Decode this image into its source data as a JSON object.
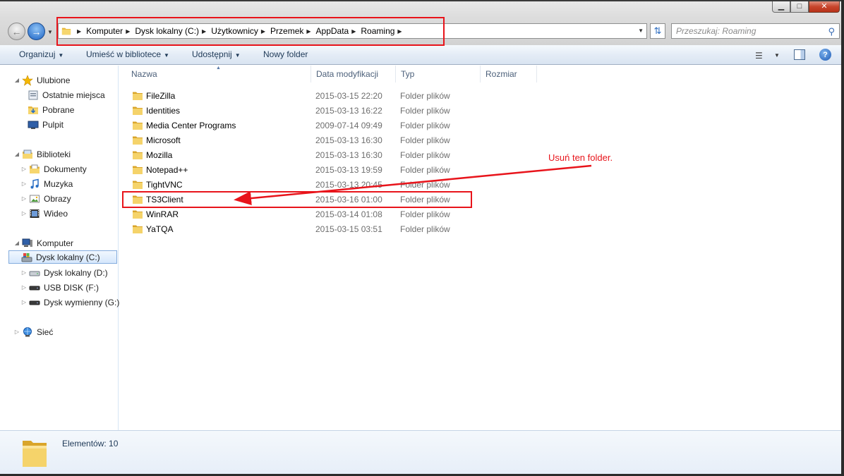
{
  "window": {
    "controls": {
      "minimize": "▁",
      "maximize": "□",
      "close": "✕"
    }
  },
  "address_bar": {
    "crumbs": [
      "Komputer",
      "Dysk lokalny (C:)",
      "Użytkownicy",
      "Przemek",
      "AppData",
      "Roaming"
    ]
  },
  "search": {
    "placeholder": "Przeszukaj: Roaming"
  },
  "command_bar": {
    "organize": "Organizuj",
    "include_library": "Umieść w bibliotece",
    "share": "Udostępnij",
    "new_folder": "Nowy folder"
  },
  "nav_pane": {
    "favorites": {
      "label": "Ulubione",
      "items": [
        "Ostatnie miejsca",
        "Pobrane",
        "Pulpit"
      ]
    },
    "libraries": {
      "label": "Biblioteki",
      "items": [
        "Dokumenty",
        "Muzyka",
        "Obrazy",
        "Wideo"
      ]
    },
    "computer": {
      "label": "Komputer",
      "items": [
        "Dysk lokalny (C:)",
        "Dysk lokalny (D:)",
        "USB DISK (F:)",
        "Dysk wymienny (G:)"
      ]
    },
    "network": {
      "label": "Sieć"
    }
  },
  "columns": {
    "name": "Nazwa",
    "date": "Data modyfikacji",
    "type": "Typ",
    "size": "Rozmiar"
  },
  "files": [
    {
      "name": "FileZilla",
      "date": "2015-03-15 22:20",
      "type": "Folder plików"
    },
    {
      "name": "Identities",
      "date": "2015-03-13 16:22",
      "type": "Folder plików"
    },
    {
      "name": "Media Center Programs",
      "date": "2009-07-14 09:49",
      "type": "Folder plików"
    },
    {
      "name": "Microsoft",
      "date": "2015-03-13 16:30",
      "type": "Folder plików"
    },
    {
      "name": "Mozilla",
      "date": "2015-03-13 16:30",
      "type": "Folder plików"
    },
    {
      "name": "Notepad++",
      "date": "2015-03-13 19:59",
      "type": "Folder plików"
    },
    {
      "name": "TightVNC",
      "date": "2015-03-13 20:45",
      "type": "Folder plików"
    },
    {
      "name": "TS3Client",
      "date": "2015-03-16 01:00",
      "type": "Folder plików"
    },
    {
      "name": "WinRAR",
      "date": "2015-03-14 01:08",
      "type": "Folder plików"
    },
    {
      "name": "YaTQA",
      "date": "2015-03-15 03:51",
      "type": "Folder plików"
    }
  ],
  "annotation": {
    "text": "Usuń ten folder."
  },
  "details": {
    "count": "Elementów: 10"
  },
  "icons": {
    "folder": "folder-icon",
    "star": "star-icon",
    "library": "library-icon",
    "computer": "computer-icon",
    "network": "network-icon",
    "drive": "drive-icon",
    "search": "search-icon",
    "help": "help-icon"
  },
  "colors": {
    "annotation_red": "#e8141b",
    "folder_yellow": "#f2c94c",
    "command_text": "#1e3957"
  }
}
